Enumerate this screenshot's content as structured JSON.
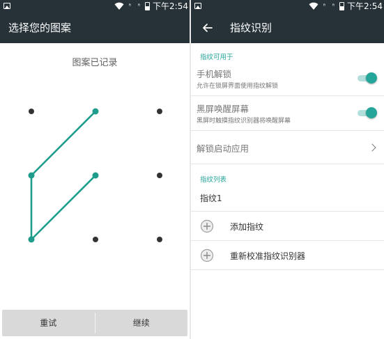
{
  "status_bar": {
    "time": "下午2:54",
    "signal_glyph_1": "ᴿ",
    "signal_glyph_2": "ᴿ",
    "icons": [
      "image-icon",
      "wifi-icon",
      "signal-icon",
      "signal-icon",
      "battery-icon"
    ]
  },
  "left": {
    "title": "选择您的图案",
    "hint": "图案已记录",
    "pattern": {
      "grid": [
        3,
        3
      ],
      "sequence": [
        [
          1,
          0
        ],
        [
          0,
          1
        ],
        [
          0,
          2
        ],
        [
          1,
          1
        ]
      ],
      "line_color": "#1f9d8c",
      "dot_color": "#333333"
    },
    "buttons": {
      "retry": "重试",
      "continue": "继续"
    }
  },
  "right": {
    "title": "指纹识别",
    "section_available": "指纹可用于",
    "unlock": {
      "title": "手机解锁",
      "subtitle": "允许在锁屏界面使用指纹解锁",
      "enabled": true
    },
    "wake": {
      "title": "黑屏唤醒屏幕",
      "subtitle": "黑屏时触摸指纹识别器将唤醒屏幕",
      "enabled": true
    },
    "launch_app": "解锁启动应用",
    "section_list": "指纹列表",
    "fingerprints": [
      "指纹1"
    ],
    "add_fingerprint": "添加指纹",
    "recalibrate": "重新校准指纹识别器"
  },
  "colors": {
    "toolbar": "#263238",
    "accent": "#26a69a",
    "toggle_track": "#b2dfdb"
  }
}
